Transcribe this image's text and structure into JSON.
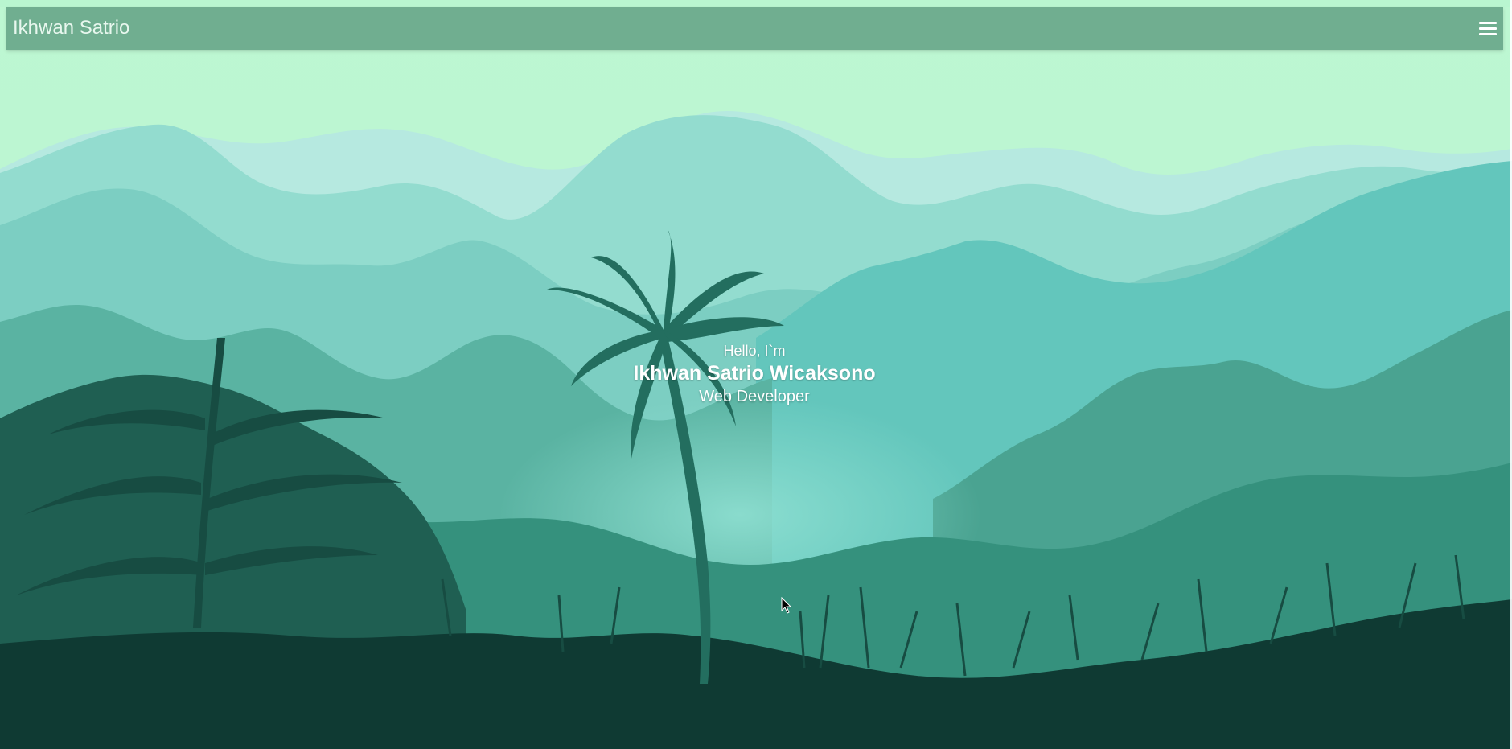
{
  "navbar": {
    "brand": "Ikhwan Satrio",
    "menu_icon": "hamburger-menu-icon"
  },
  "hero": {
    "greeting": "Hello, I`m",
    "name": "Ikhwan Satrio Wicaksono",
    "role": "Web Developer"
  },
  "colors": {
    "sky": "#b9f6d0",
    "navbar": "#70ae90",
    "far_hills": "#b6e9e0",
    "mid_hills": "#8fdbcf",
    "near_hills": "#62c7bb",
    "forest": "#3c9a86",
    "deep_forest": "#2a7a69",
    "foreground": "#0f3a33"
  }
}
